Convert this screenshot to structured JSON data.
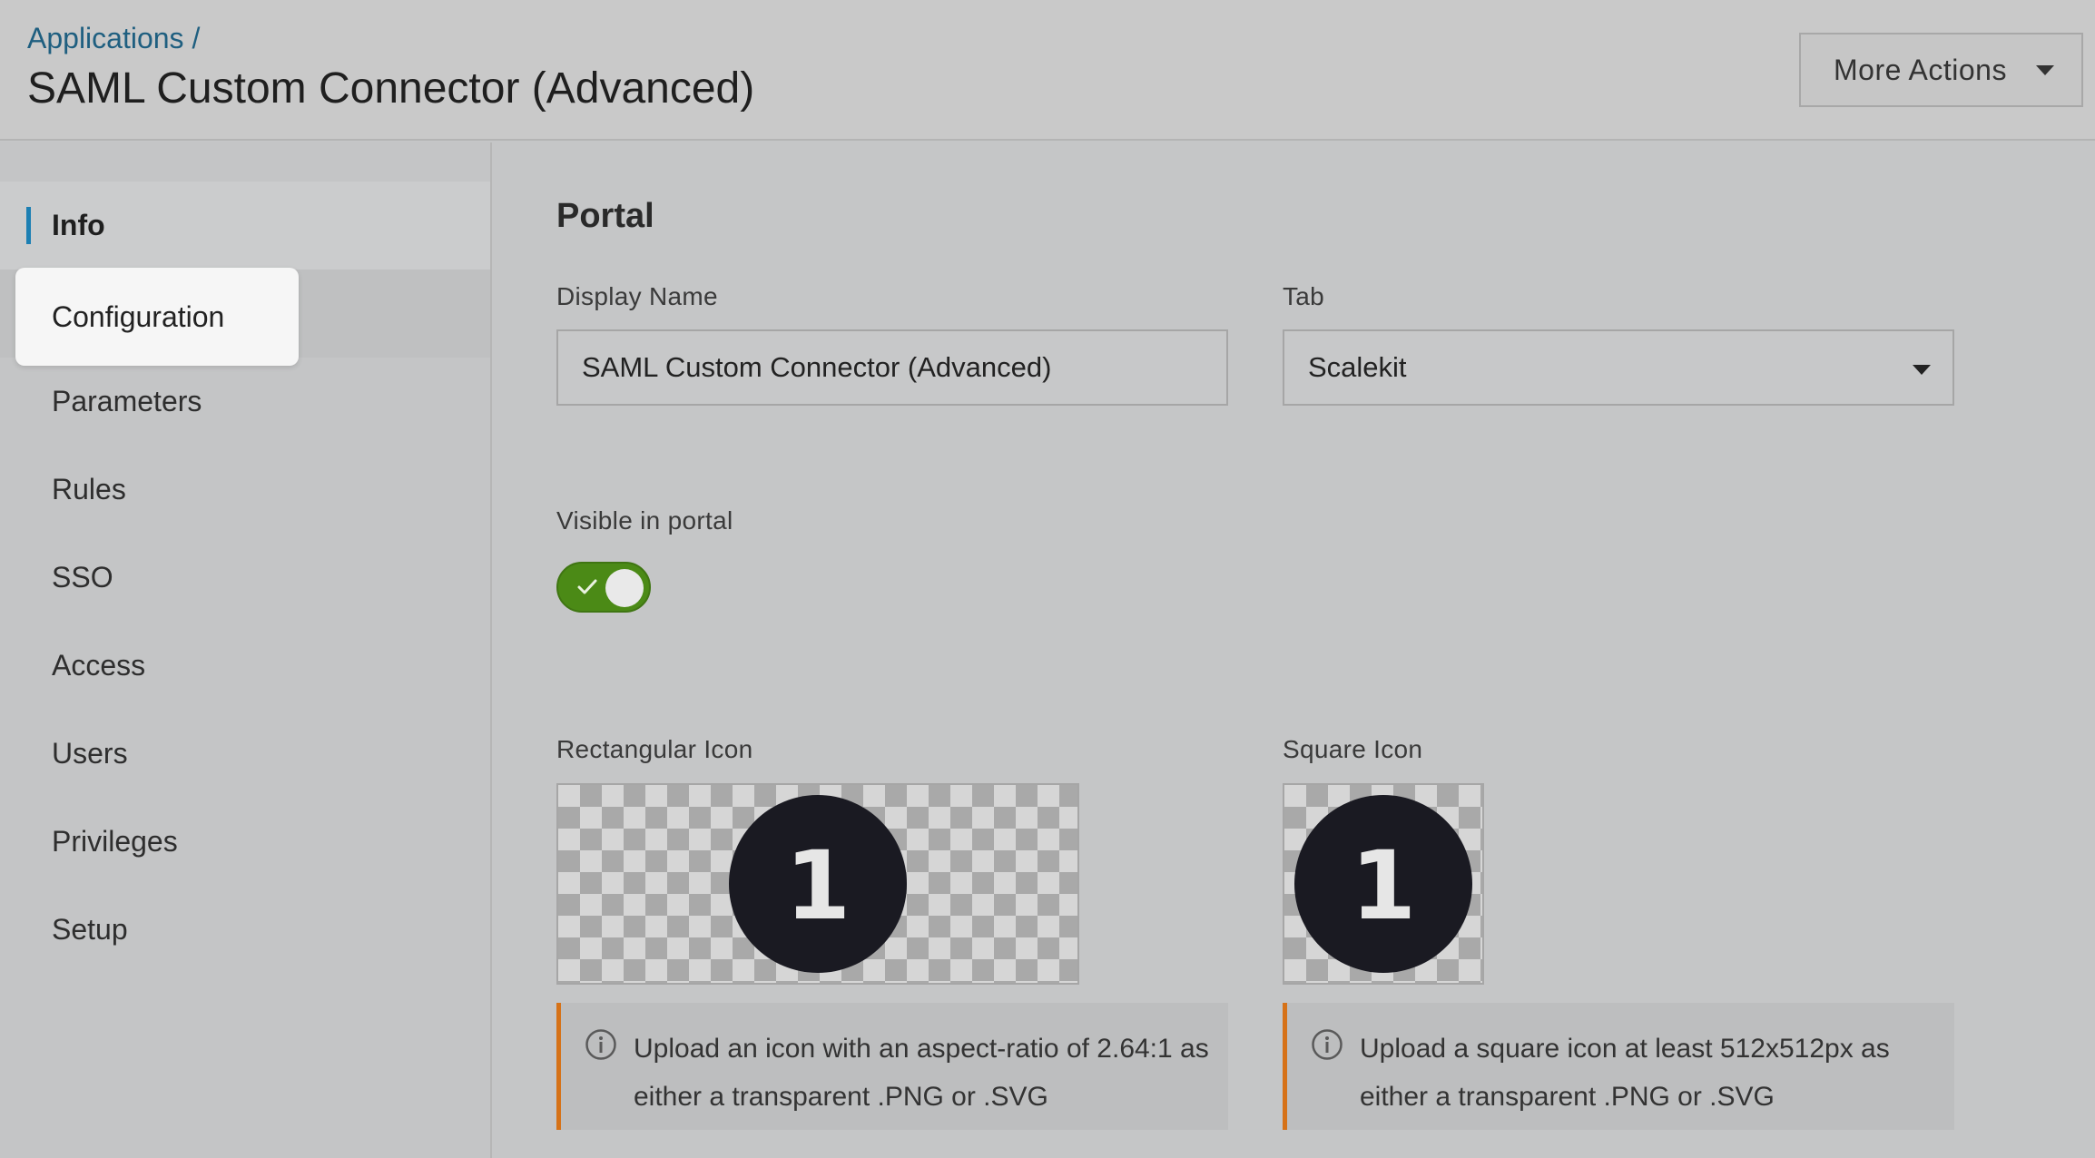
{
  "header": {
    "breadcrumb": "Applications /",
    "title": "SAML Custom Connector (Advanced)",
    "more_actions": "More Actions"
  },
  "sidebar": {
    "items": [
      {
        "label": "Info",
        "active": true
      },
      {
        "label": "Configuration",
        "highlighted": true
      },
      {
        "label": "Parameters"
      },
      {
        "label": "Rules"
      },
      {
        "label": "SSO"
      },
      {
        "label": "Access"
      },
      {
        "label": "Users"
      },
      {
        "label": "Privileges"
      },
      {
        "label": "Setup"
      }
    ]
  },
  "portal": {
    "section_title": "Portal",
    "display_name_label": "Display Name",
    "display_name_value": "SAML Custom Connector (Advanced)",
    "tab_label": "Tab",
    "tab_value": "Scalekit",
    "visible_label": "Visible in portal",
    "visible_on": true,
    "rect_icon_label": "Rectangular Icon",
    "square_icon_label": "Square Icon",
    "logo_glyph": "1",
    "rect_note_line1": "Upload an icon with an aspect-ratio of 2.64:1 as",
    "rect_note_line2": "either a transparent .PNG or .SVG",
    "square_note_line1": "Upload a square icon at least 512x512px as",
    "square_note_line2": "either a transparent .PNG or .SVG"
  },
  "colors": {
    "accent": "#1c7fb3",
    "toggle_on": "#4b8a16",
    "note_border": "#d67218"
  }
}
